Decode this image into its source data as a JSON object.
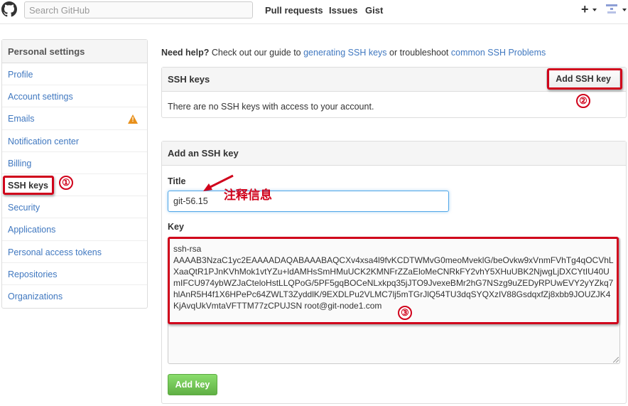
{
  "header": {
    "search_placeholder": "Search GitHub",
    "nav": [
      "Pull requests",
      "Issues",
      "Gist"
    ],
    "plus_label": "+"
  },
  "sidebar": {
    "title": "Personal settings",
    "items": [
      {
        "label": "Profile"
      },
      {
        "label": "Account settings"
      },
      {
        "label": "Emails",
        "warning": true
      },
      {
        "label": "Notification center"
      },
      {
        "label": "Billing"
      },
      {
        "label": "SSH keys",
        "selected": true
      },
      {
        "label": "Security"
      },
      {
        "label": "Applications"
      },
      {
        "label": "Personal access tokens"
      },
      {
        "label": "Repositories"
      },
      {
        "label": "Organizations"
      }
    ]
  },
  "help": {
    "need_help": "Need help?",
    "text1": " Check out our guide to ",
    "link1": "generating SSH keys",
    "text2": " or troubleshoot ",
    "link2": "common SSH Problems"
  },
  "ssh_panel": {
    "title": "SSH keys",
    "add_button": "Add SSH key",
    "empty_text": "There are no SSH keys with access to your account."
  },
  "add_panel": {
    "title": "Add an SSH key",
    "title_label": "Title",
    "title_value": "git-56.15",
    "key_label": "Key",
    "key_value": "ssh-rsa\nAAAAB3NzaC1yc2EAAAADAQABAAABAQCXv4xsa4l9fvKCDTWMvG0meoMveklG/beOvkw9xVnmFVhTg4qOCVhLXaaQtR1PJnKVhMok1vtYZu+ldAMHsSmHMuUCK2KMNFrZZaEloMeCNRkFY2vhY5XHuUBK2NjwgLjDXCYtIU40UmIFCU974ybWZJaCteloHstLLQPoG/5PF5gqBOCeNLxkpq35jJTO9JvexeBMr2hG7NSzg9uZEDyRPUwEVY2yYZkq7hlAnR5H4f1X6HPePc64ZWLT3ZyddlK/9EXDLPu2VLMC7lj5mTGrJlQ54TU3dqSYQXzIV88GsdqxfZj8xbb9JOUZJK4KjAvqUkVmtaVFTTM77zCPUJSN root@git-node1.com",
    "submit": "Add key"
  },
  "annotations": {
    "circle1": "①",
    "circle2": "②",
    "circle3": "③",
    "callout_text": "注释信息"
  },
  "colors": {
    "annotation_red": "#d0021b",
    "link_blue": "#4078c0",
    "button_green": "#60b044",
    "warning_orange": "#e8901b"
  }
}
